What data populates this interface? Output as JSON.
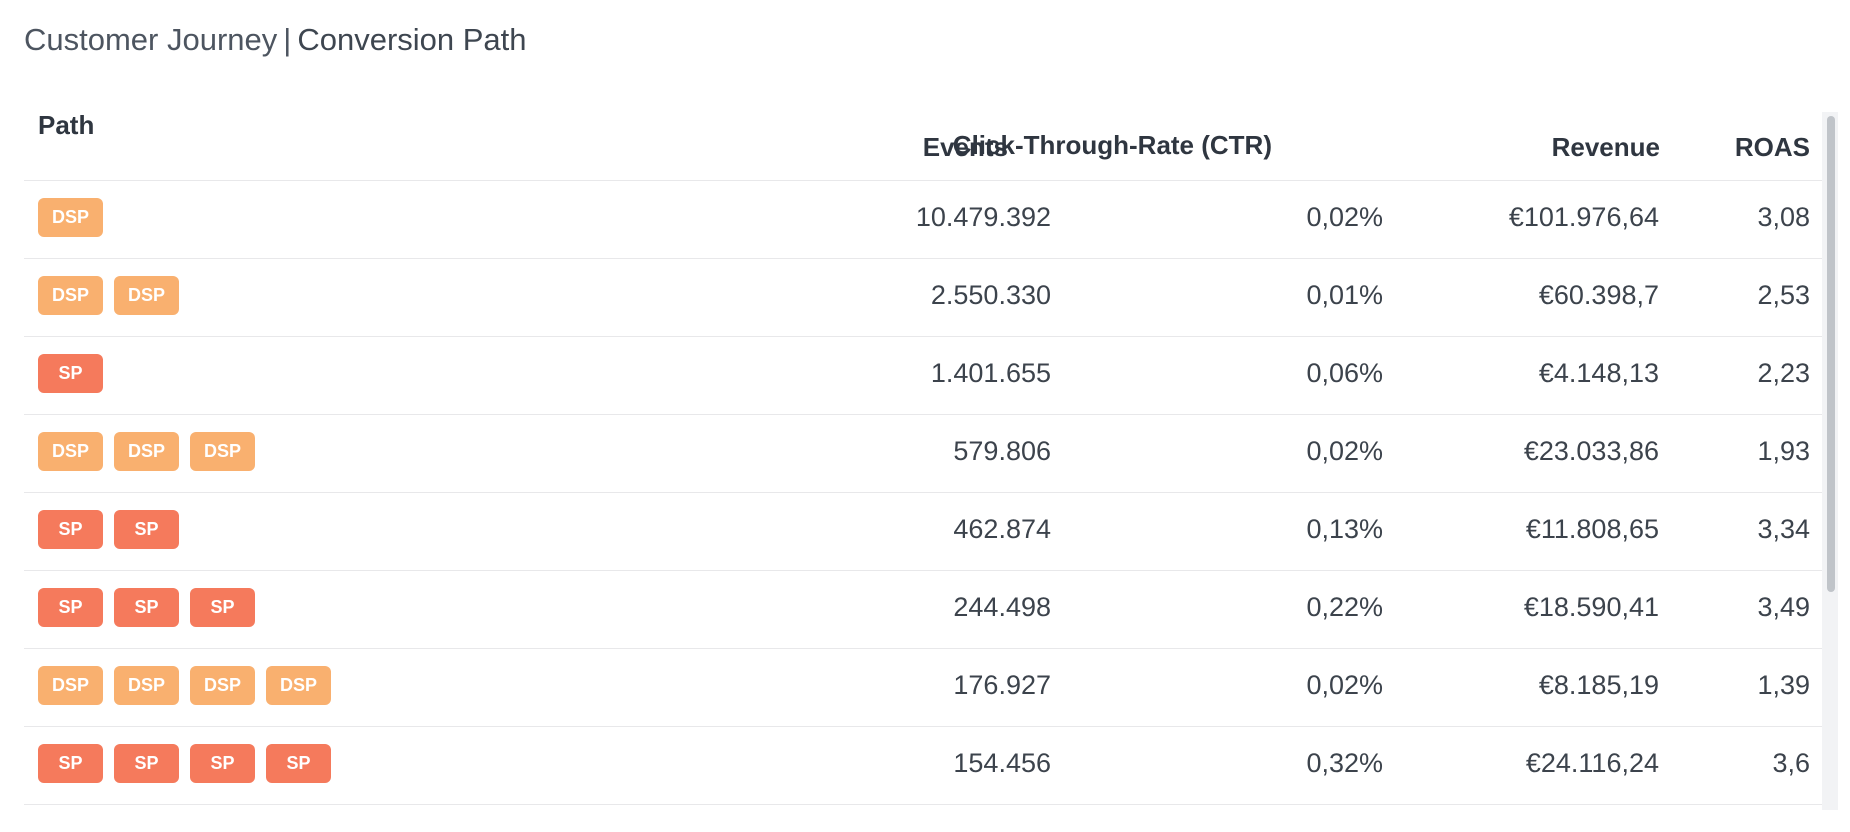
{
  "title": {
    "primary": "Customer Journey",
    "separator": "|",
    "secondary": "Conversion Path"
  },
  "columns": {
    "path": "Path",
    "events": "Events",
    "ctr": "Click-Through-Rate (CTR)",
    "revenue": "Revenue",
    "roas": "ROAS"
  },
  "badge_colors": {
    "DSP": "#f9b06f",
    "SP": "#f57a5c"
  },
  "rows": [
    {
      "path": [
        "DSP"
      ],
      "events": "10.479.392",
      "ctr": "0,02%",
      "revenue": "€101.976,64",
      "roas": "3,08"
    },
    {
      "path": [
        "DSP",
        "DSP"
      ],
      "events": "2.550.330",
      "ctr": "0,01%",
      "revenue": "€60.398,7",
      "roas": "2,53"
    },
    {
      "path": [
        "SP"
      ],
      "events": "1.401.655",
      "ctr": "0,06%",
      "revenue": "€4.148,13",
      "roas": "2,23"
    },
    {
      "path": [
        "DSP",
        "DSP",
        "DSP"
      ],
      "events": "579.806",
      "ctr": "0,02%",
      "revenue": "€23.033,86",
      "roas": "1,93"
    },
    {
      "path": [
        "SP",
        "SP"
      ],
      "events": "462.874",
      "ctr": "0,13%",
      "revenue": "€11.808,65",
      "roas": "3,34"
    },
    {
      "path": [
        "SP",
        "SP",
        "SP"
      ],
      "events": "244.498",
      "ctr": "0,22%",
      "revenue": "€18.590,41",
      "roas": "3,49"
    },
    {
      "path": [
        "DSP",
        "DSP",
        "DSP",
        "DSP"
      ],
      "events": "176.927",
      "ctr": "0,02%",
      "revenue": "€8.185,19",
      "roas": "1,39"
    },
    {
      "path": [
        "SP",
        "SP",
        "SP",
        "SP"
      ],
      "events": "154.456",
      "ctr": "0,32%",
      "revenue": "€24.116,24",
      "roas": "3,6"
    }
  ]
}
